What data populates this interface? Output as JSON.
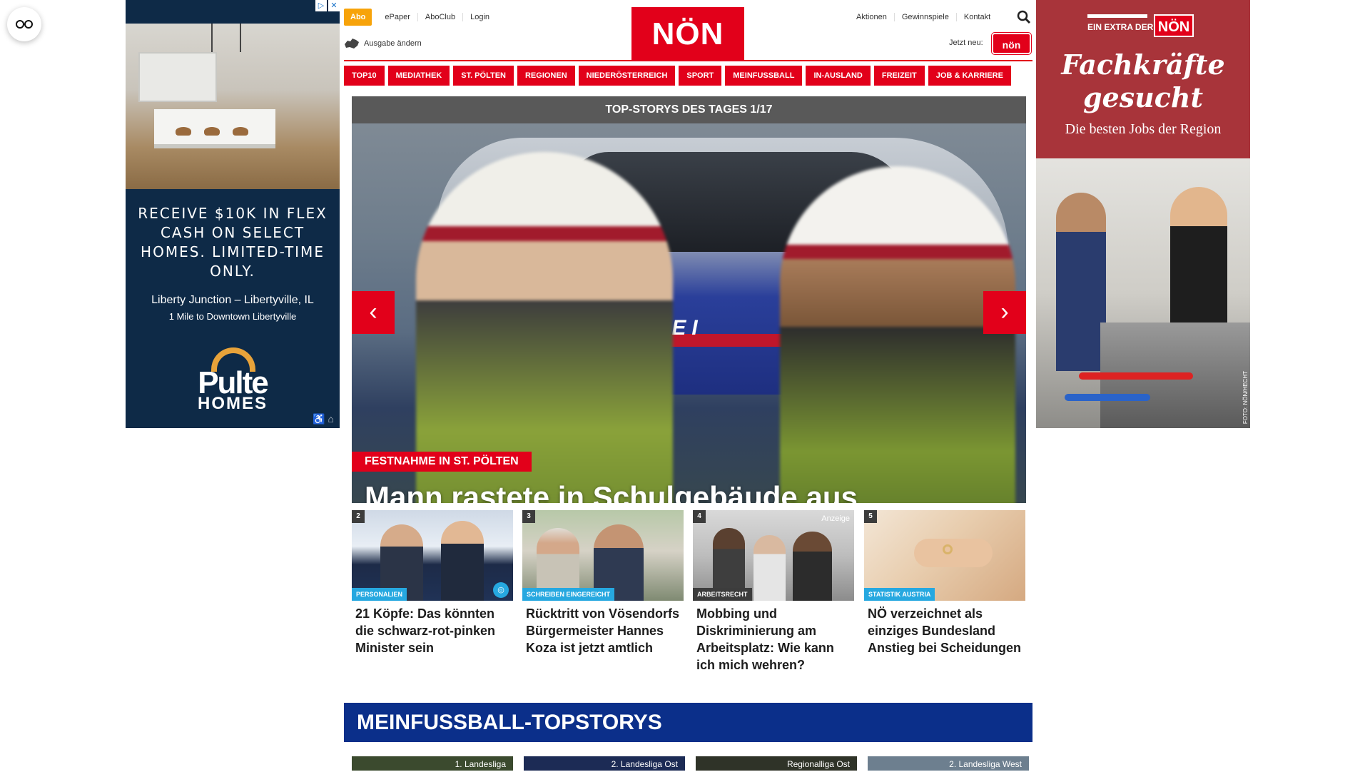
{
  "reader_button": {
    "icon": "glasses-icon"
  },
  "ad_left": {
    "adchoices_icons": [
      "info-icon",
      "close-icon"
    ],
    "headline": "RECEIVE $10K IN FLEX CASH ON SELECT HOMES. LIMITED-TIME ONLY.",
    "location": "Liberty Junction – Libertyville, IL",
    "distance": "1 Mile to Downtown Libertyville",
    "logo_line1": "Pulte",
    "logo_line2": "HOMES",
    "accessibility": "♿ ⌂"
  },
  "ad_right": {
    "extra_label": "EIN EXTRA DER",
    "badge": "NÖN",
    "slogan": "Fachkräfte gesucht",
    "subline": "Die besten Jobs der Region",
    "credit": "FOTO: NÖN/HECHT"
  },
  "header": {
    "abo": "Abo",
    "top_links": [
      "ePaper",
      "AboClub",
      "Login"
    ],
    "ausgabe": "Ausgabe ändern",
    "logo": "NÖN",
    "right_links": [
      "Aktionen",
      "Gewinnspiele",
      "Kontakt"
    ],
    "jetzt_neu": "Jetzt neu:",
    "jetzt_badge": "nön"
  },
  "nav": [
    "TOP10",
    "MEDIATHEK",
    "ST. PÖLTEN",
    "REGIONEN",
    "NIEDERÖSTERREICH",
    "SPORT",
    "MEINFUSSBALL",
    "IN-AUSLAND",
    "FREIZEIT",
    "JOB & KARRIERE"
  ],
  "hero": {
    "bar_title": "TOP-STORYS DES TAGES 1/17",
    "car_text": "POLIZEI",
    "kicker": "FESTNAHME IN ST. PÖLTEN",
    "title": "Mann rastete in Schulgebäude aus",
    "prev": "‹",
    "next": "›"
  },
  "teasers": [
    {
      "num": "2",
      "kicker": "PERSONALIEN",
      "title": "21 Köpfe: Das könnten die schwarz-rot-pinken Minister sein",
      "has_camera": true
    },
    {
      "num": "3",
      "kicker": "SCHREIBEN EINGEREICHT",
      "title": "Rücktritt von Vösendorfs Bürgermeister Hannes Koza ist jetzt amtlich"
    },
    {
      "num": "4",
      "kicker": "ARBEITSRECHT",
      "title": "Mobbing und Diskriminierung am Arbeitsplatz: Wie kann ich mich wehren?",
      "anzeige": "Anzeige"
    },
    {
      "num": "5",
      "kicker": "STATISTIK AUSTRIA",
      "title": "NÖ verzeichnet als einziges Bundesland Anstieg bei Scheidungen"
    }
  ],
  "meinfussball": {
    "title": "MEINFUSSBALL-TOPSTORYS",
    "cards": [
      "1. Landesliga",
      "2. Landesliga Ost",
      "Regionalliga Ost",
      "2. Landesliga West"
    ]
  },
  "colors": {
    "brand_red": "#e2001a",
    "abo_orange": "#f7a30a",
    "kicker_blue": "#26a8e0",
    "mf_blue": "#0b2f8a"
  }
}
